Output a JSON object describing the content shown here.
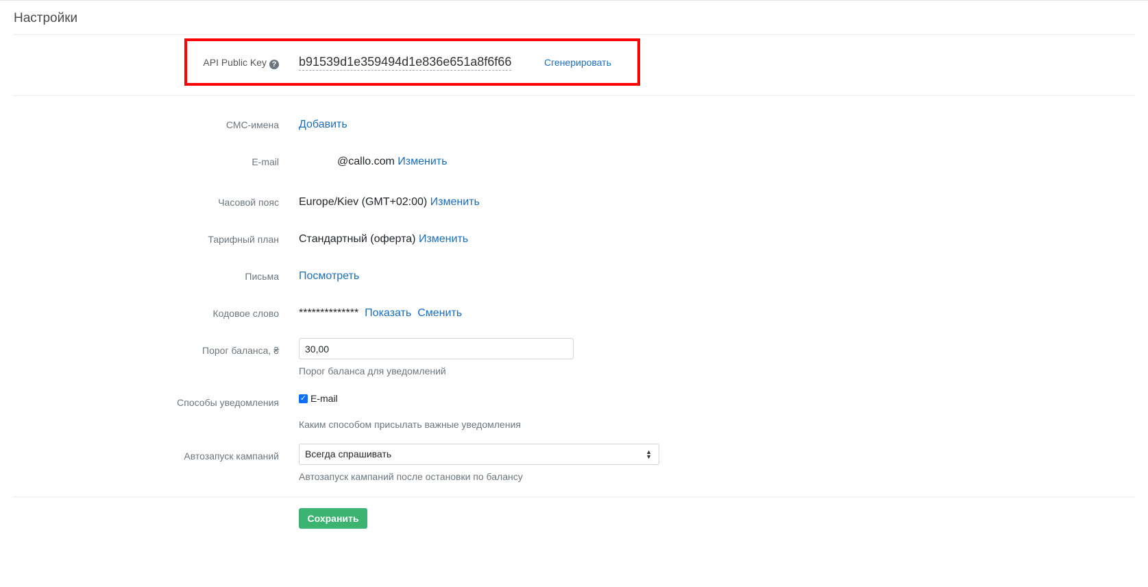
{
  "page": {
    "title": "Настройки"
  },
  "api": {
    "label": "API Public Key",
    "help_icon": "question-circle-icon",
    "key": "b91539d1e359494d1e836e651a8f6f66",
    "generate": "Сгенерировать"
  },
  "sms": {
    "label": "СМС-имена",
    "add": "Добавить"
  },
  "email": {
    "label": "E-mail",
    "value": "@callo.com",
    "change": "Изменить"
  },
  "timezone": {
    "label": "Часовой пояс",
    "value": "Europe/Kiev (GMT+02:00)",
    "change": "Изменить"
  },
  "tariff": {
    "label": "Тарифный план",
    "value": "Стандартный (оферта)",
    "change": "Изменить"
  },
  "letters": {
    "label": "Письма",
    "view": "Посмотреть"
  },
  "codeword": {
    "label": "Кодовое слово",
    "value": "**************",
    "show": "Показать",
    "change": "Сменить"
  },
  "balance": {
    "label": "Порог баланса, ₴",
    "value": "30,00",
    "hint": "Порог баланса для уведомлений"
  },
  "notify": {
    "label": "Способы уведомления",
    "option": "E-mail",
    "checked": true,
    "hint": "Каким способом присылать важные уведомления"
  },
  "autostart": {
    "label": "Автозапуск кампаний",
    "selected": "Всегда спрашивать",
    "hint": "Автозапуск кампаний после остановки по балансу"
  },
  "save": "Сохранить",
  "colors": {
    "link": "#1a6dbd",
    "highlight": "#ff0000",
    "save": "#3cb371",
    "checkbox": "#0d6efd"
  }
}
